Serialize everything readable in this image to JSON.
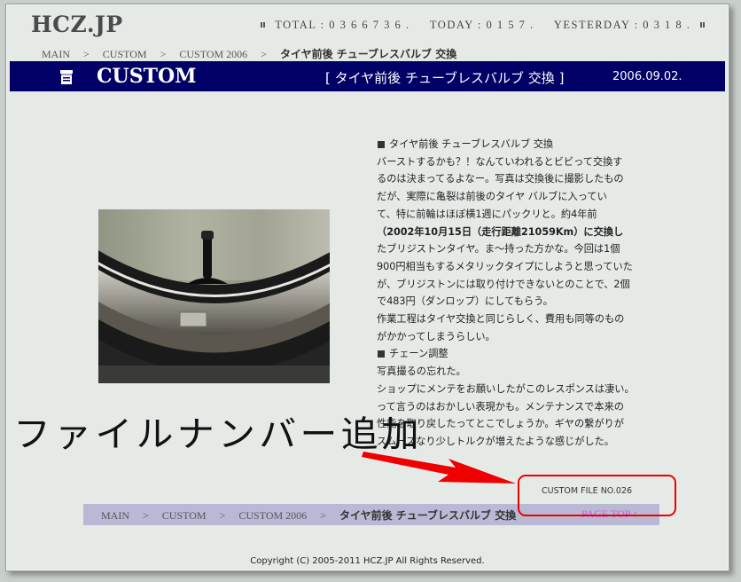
{
  "site": {
    "logo": "HCZ.JP"
  },
  "counter": {
    "total": "TOTAL : 0 3 6 6 7 3 6 .",
    "today": "TODAY : 0 1 5 7 .",
    "yesterday": "YESTERDAY : 0 3 1 8 ."
  },
  "breadcrumb": [
    {
      "label": "MAIN"
    },
    {
      "label": "CUSTOM"
    },
    {
      "label": "CUSTOM 2006"
    },
    {
      "label": "タイヤ前後 チューブレスバルブ 交換"
    }
  ],
  "breadcrumb_sep": ">",
  "header": {
    "section": "CUSTOM",
    "page_title": "[ タイヤ前後 チューブレスバルブ 交換 ]",
    "date": "2006.09.02."
  },
  "article": {
    "lines": [
      "タイヤ前後 チューブレスバルブ 交換",
      "バーストするかも？！なんていわれるとビビって交換す",
      "るのは決まってるよなー。写真は交換後に撮影したもの",
      "だが、実際に亀裂は前後のタイヤ バルブに入ってい",
      "て、特に前輪はほぼ横1週にパックリと。約4年前",
      "（2002年10月15日（走行距離21059Km）に交換し",
      "たブリジストンタイヤ。ま～持った方かな。今回は1個",
      "900円相当もするメタリックタイプにしようと思っていた",
      "が、ブリジストンには取り付けできないとのことで、2個",
      "で483円（ダンロップ）にしてもらう。",
      "作業工程はタイヤ交換と同じらしく、費用も同等のもの",
      "がかかってしまうらしい。",
      "チェーン調整",
      "写真撮るの忘れた。",
      "ショップにメンテをお願いしたがこのレスポンスは凄い。",
      "って言うのはおかしい表現かも。メンテナンスで本来の",
      "性能を取り戻したってとこでしょうか。ギヤの繋がりが",
      "スムーズなり少しトルクが増えたような感じがした。"
    ]
  },
  "file_number": "CUSTOM FILE NO.026",
  "annotation": "ファイルナンバー追加",
  "page_top": "PAGE TOP ↑",
  "copyright": "Copyright (C) 2005-2011 HCZ.JP All Rights Reserved.",
  "colors": {
    "header_bg": "#000066",
    "bottom_bar": "#b9b9d6",
    "annotation_red": "#ee0000",
    "page_top_link": "#c05fd8"
  }
}
